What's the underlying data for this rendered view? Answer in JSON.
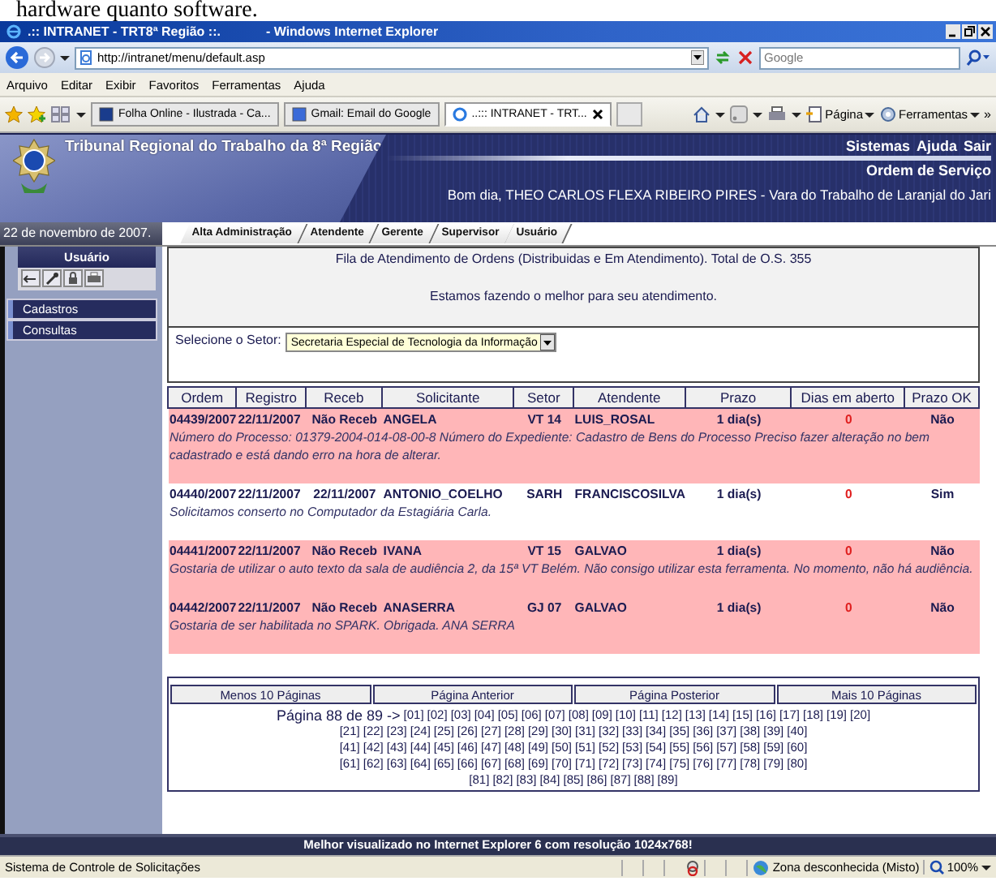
{
  "caption_fragment": "hardware quanto software.",
  "browser": {
    "page_title": ".:: INTRANET - TRT8ª Região ::.",
    "app_name": "- Windows Internet Explorer",
    "address": "http://intranet/menu/default.asp",
    "search_placeholder": "Google",
    "menu": [
      "Arquivo",
      "Editar",
      "Exibir",
      "Favoritos",
      "Ferramentas",
      "Ajuda"
    ],
    "tabs": [
      {
        "label": "Folha Online - Ilustrada - Ca...",
        "selected": false
      },
      {
        "label": "Gmail: Email do Google",
        "selected": false
      },
      {
        "label": "..::: INTRANET - TRT...",
        "selected": true
      }
    ],
    "tools": [
      "Página",
      "Ferramentas"
    ],
    "overflow": "»"
  },
  "site": {
    "title": "Tribunal Regional do Trabalho da 8ª Região",
    "top_links": [
      "Sistemas",
      "Ajuda",
      "Sair"
    ],
    "section": "Ordem de Serviço",
    "greeting": "Bom dia, THEO CARLOS FLEXA RIBEIRO PIRES - Vara do Trabalho de Laranjal do Jari",
    "date": "22 de novembro de 2007.",
    "nav_tabs": [
      "Alta Administração",
      "Atendente",
      "Gerente",
      "Supervisor",
      "Usuário"
    ]
  },
  "sidebar": {
    "heading": "Usuário",
    "items": [
      "Cadastros",
      "Consultas"
    ]
  },
  "queue": {
    "title": "Fila de Atendimento de Ordens (Distribuidas e Em Atendimento). Total de O.S. 355",
    "motto": "Estamos fazendo o melhor para seu atendimento.",
    "sector_label": "Selecione o Setor:",
    "sector_value": "Secretaria Especial de Tecnologia da Informação",
    "columns": [
      "Ordem",
      "Registro",
      "Receb",
      "Solicitante",
      "Setor",
      "Atendente",
      "Prazo",
      "Dias em aberto",
      "Prazo OK"
    ],
    "rows": [
      {
        "cells": [
          "04439/2007",
          "22/11/2007",
          "Não Receb",
          "ANGELA",
          "VT 14",
          "LUIS_ROSAL",
          "1 dia(s)",
          "0",
          "Não"
        ],
        "description": "Número do Processo: 01379-2004-014-08-00-8 Número do Expediente: Cadastro de Bens do Processo Preciso fazer alteração no bem cadastrado e está dando erro na hora de alterar.",
        "highlighted": true
      },
      {
        "cells": [
          "04440/2007",
          "22/11/2007",
          "22/11/2007",
          "ANTONIO_COELHO",
          "SARH",
          "FRANCISCOSILVA",
          "1 dia(s)",
          "0",
          "Sim"
        ],
        "description": "Solicitamos conserto no Computador da Estagiária Carla.",
        "highlighted": false
      },
      {
        "cells": [
          "04441/2007",
          "22/11/2007",
          "Não Receb",
          "IVANA",
          "VT 15",
          "GALVAO",
          "1 dia(s)",
          "0",
          "Não"
        ],
        "description": "Gostaria de utilizar o auto texto da sala de audiência 2, da 15ª VT Belém. Não consigo utilizar esta ferramenta. No momento, não há audiência.",
        "highlighted": true
      },
      {
        "cells": [
          "04442/2007",
          "22/11/2007",
          "Não Receb",
          "ANASERRA",
          "GJ 07",
          "GALVAO",
          "1 dia(s)",
          "0",
          "Não"
        ],
        "description": "Gostaria de ser habilitada no SPARK. Obrigada. ANA SERRA",
        "highlighted": true
      }
    ],
    "pager_buttons": [
      "Menos 10 Páginas",
      "Página Anterior",
      "Página Posterior",
      "Mais 10 Páginas"
    ],
    "page_info": "Página 88 de 89 ->",
    "page_links": [
      "[01]",
      "[02]",
      "[03]",
      "[04]",
      "[05]",
      "[06]",
      "[07]",
      "[08]",
      "[09]",
      "[10]",
      "[11]",
      "[12]",
      "[13]",
      "[14]",
      "[15]",
      "[16]",
      "[17]",
      "[18]",
      "[19]",
      "[20]",
      "[21]",
      "[22]",
      "[23]",
      "[24]",
      "[25]",
      "[26]",
      "[27]",
      "[28]",
      "[29]",
      "[30]",
      "[31]",
      "[32]",
      "[33]",
      "[34]",
      "[35]",
      "[36]",
      "[37]",
      "[38]",
      "[39]",
      "[40]",
      "[41]",
      "[42]",
      "[43]",
      "[44]",
      "[45]",
      "[46]",
      "[47]",
      "[48]",
      "[49]",
      "[50]",
      "[51]",
      "[52]",
      "[53]",
      "[54]",
      "[55]",
      "[56]",
      "[57]",
      "[58]",
      "[59]",
      "[60]",
      "[61]",
      "[62]",
      "[63]",
      "[64]",
      "[65]",
      "[66]",
      "[67]",
      "[68]",
      "[69]",
      "[70]",
      "[71]",
      "[72]",
      "[73]",
      "[74]",
      "[75]",
      "[76]",
      "[77]",
      "[78]",
      "[79]",
      "[80]",
      "[81]",
      "[82]",
      "[83]",
      "[84]",
      "[85]",
      "[86]",
      "[87]",
      "[88]",
      "[89]"
    ]
  },
  "footer_note": "Melhor visualizado no Internet Explorer 6 com resolução 1024x768!",
  "status_bar": {
    "text": "Sistema de Controle de Solicitações",
    "zone": "Zona desconhecida (Misto)",
    "zoom": "100%"
  }
}
